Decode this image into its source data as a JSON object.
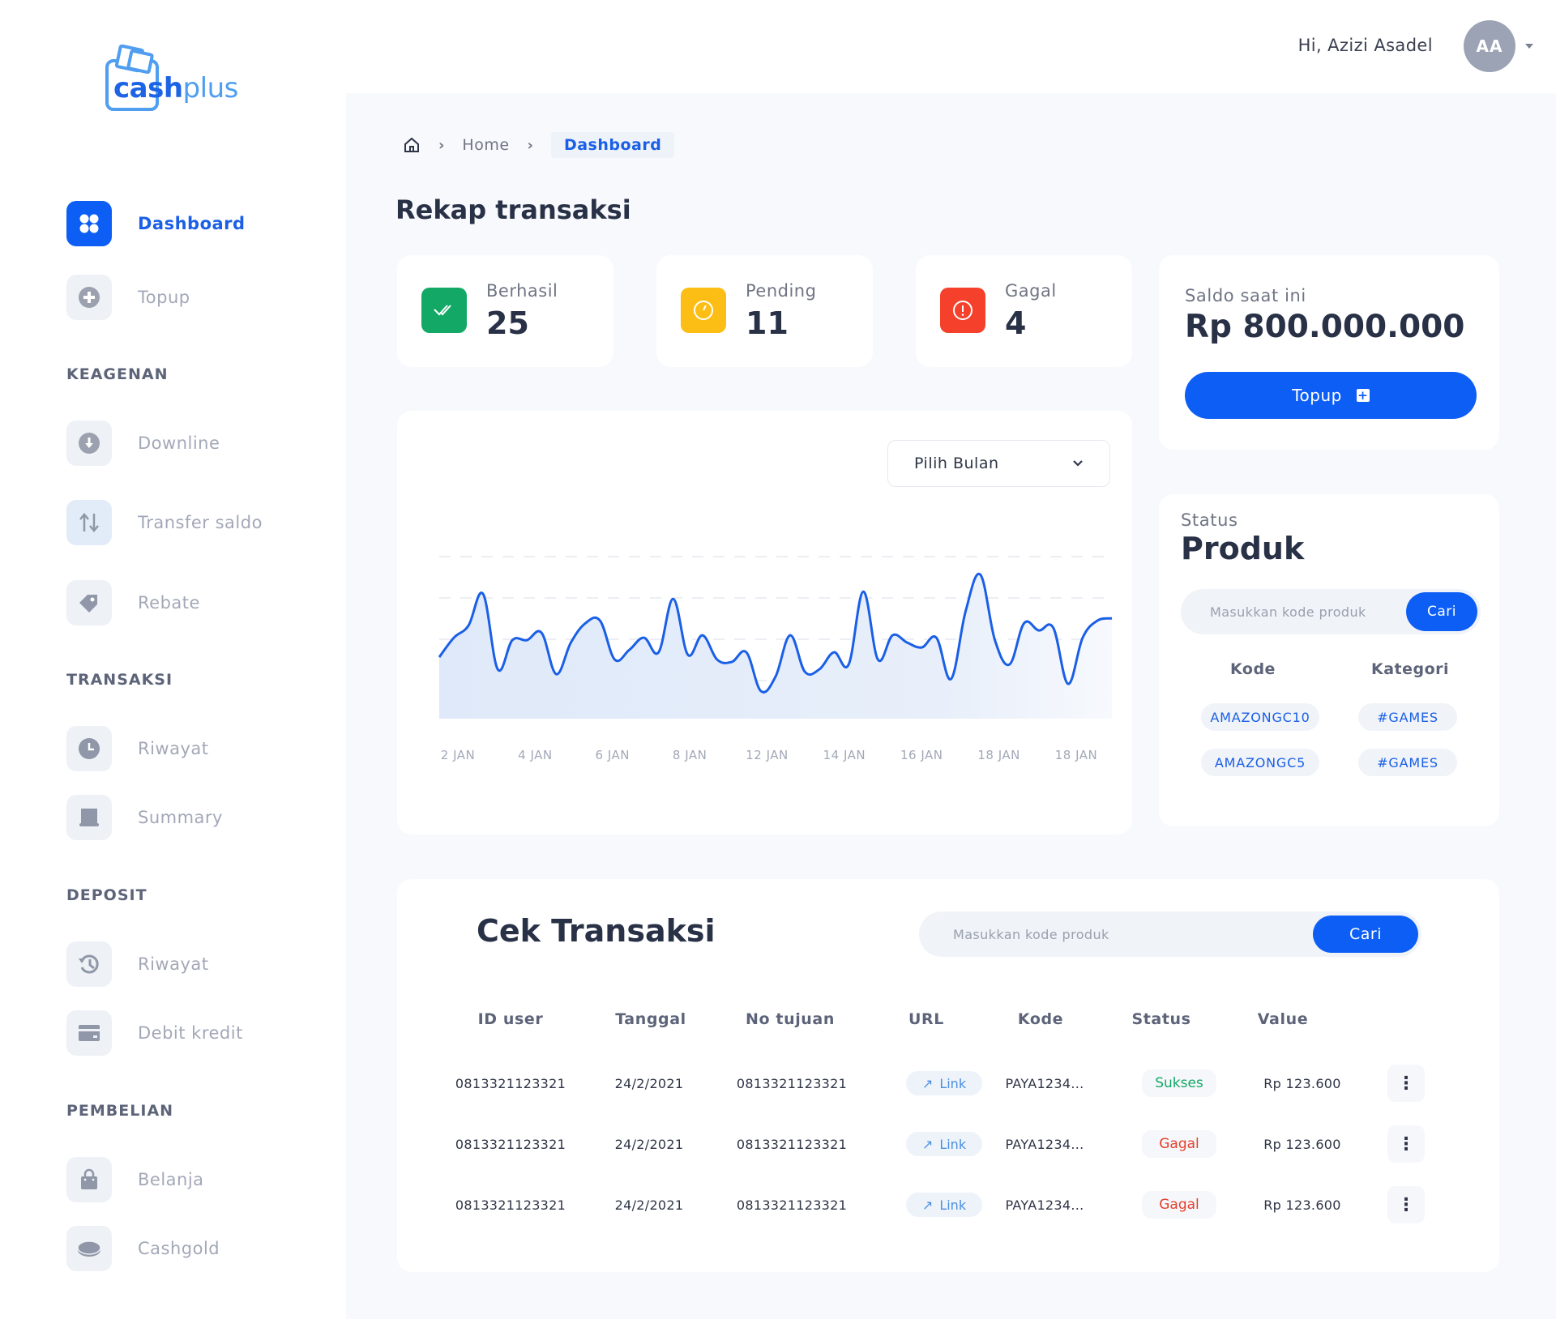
{
  "brand": {
    "name_part1": "cash",
    "name_part2": "plus"
  },
  "header": {
    "greeting": "Hi, Azizi Asadel",
    "avatar_initials": "AA"
  },
  "sidebar": {
    "items": [
      {
        "label": "Dashboard",
        "icon": "grid-icon",
        "active": true
      },
      {
        "label": "Topup",
        "icon": "plus-circle-icon"
      }
    ],
    "sections": [
      {
        "title": "KEAGENAN",
        "items": [
          {
            "label": "Downline",
            "icon": "arrow-down-circle-icon"
          },
          {
            "label": "Transfer saldo",
            "icon": "transfer-arrows-icon"
          },
          {
            "label": "Rebate",
            "icon": "tag-icon"
          }
        ]
      },
      {
        "title": "TRANSAKSI",
        "items": [
          {
            "label": "Riwayat",
            "icon": "clock-icon"
          },
          {
            "label": "Summary",
            "icon": "receipt-icon"
          }
        ]
      },
      {
        "title": "DEPOSIT",
        "items": [
          {
            "label": "Riwayat",
            "icon": "history-icon"
          },
          {
            "label": "Debit kredit",
            "icon": "card-icon"
          }
        ]
      },
      {
        "title": "PEMBELIAN",
        "items": [
          {
            "label": "Belanja",
            "icon": "shopping-bag-icon"
          },
          {
            "label": "Cashgold",
            "icon": "coin-icon"
          }
        ]
      }
    ]
  },
  "breadcrumb": {
    "home": "Home",
    "current": "Dashboard"
  },
  "page_title": "Rekap transaksi",
  "stats": [
    {
      "label": "Berhasil",
      "value": "25",
      "color": "#13a865",
      "icon": "double-check-icon"
    },
    {
      "label": "Pending",
      "value": "11",
      "color": "#fcbd14",
      "icon": "timer-icon"
    },
    {
      "label": "Gagal",
      "value": "4",
      "color": "#f5402c",
      "icon": "alert-circle-icon"
    }
  ],
  "saldo": {
    "label": "Saldo saat ini",
    "value": "Rp 800.000.000",
    "button_label": "Topup"
  },
  "chart": {
    "select_label": "Pilih Bulan"
  },
  "chart_data": {
    "type": "area",
    "title": "",
    "xlabel": "",
    "ylabel": "",
    "x_tick_labels": [
      "2 JAN",
      "4 JAN",
      "6 JAN",
      "8 JAN",
      "12 JAN",
      "14 JAN",
      "16 JAN",
      "18 JAN",
      "18 JAN"
    ],
    "ylim": [
      0,
      100
    ],
    "grid": "horizontal-dashed",
    "series": [
      {
        "name": "transaksi",
        "color": "#1a5fe6",
        "values": [
          32,
          48,
          58,
          84,
          22,
          46,
          46,
          52,
          18,
          44,
          60,
          62,
          30,
          38,
          48,
          36,
          80,
          34,
          50,
          30,
          28,
          36,
          4,
          16,
          50,
          20,
          22,
          36,
          26,
          86,
          30,
          50,
          44,
          40,
          48,
          14,
          70,
          100,
          46,
          26,
          60,
          54,
          56,
          10,
          48,
          62,
          64
        ]
      }
    ]
  },
  "produk": {
    "status_label": "Status",
    "title": "Produk",
    "search_placeholder": "Masukkan kode produk",
    "search_button": "Cari",
    "col_kode": "Kode",
    "col_kategori": "Kategori",
    "rows": [
      {
        "kode": "AMAZONGC10",
        "kategori": "#GAMES"
      },
      {
        "kode": "AMAZONGC5",
        "kategori": "#GAMES"
      }
    ]
  },
  "cek_transaksi": {
    "title": "Cek Transaksi",
    "search_placeholder": "Masukkan kode produk",
    "search_button": "Cari",
    "columns": [
      "ID user",
      "Tanggal",
      "No tujuan",
      "URL",
      "Kode",
      "Status",
      "Value"
    ],
    "rows": [
      {
        "id_user": "0813321123321",
        "tanggal": "24/2/2021",
        "no_tujuan": "0813321123321",
        "url": "Link",
        "kode": "PAYA1234...",
        "status": "Sukses",
        "status_color": "#13a865",
        "value": "Rp 123.600"
      },
      {
        "id_user": "0813321123321",
        "tanggal": "24/2/2021",
        "no_tujuan": "0813321123321",
        "url": "Link",
        "kode": "PAYA1234...",
        "status": "Gagal",
        "status_color": "#e5402c",
        "value": "Rp 123.600"
      },
      {
        "id_user": "0813321123321",
        "tanggal": "24/2/2021",
        "no_tujuan": "0813321123321",
        "url": "Link",
        "kode": "PAYA1234...",
        "status": "Gagal",
        "status_color": "#e5402c",
        "value": "Rp 123.600"
      }
    ]
  }
}
